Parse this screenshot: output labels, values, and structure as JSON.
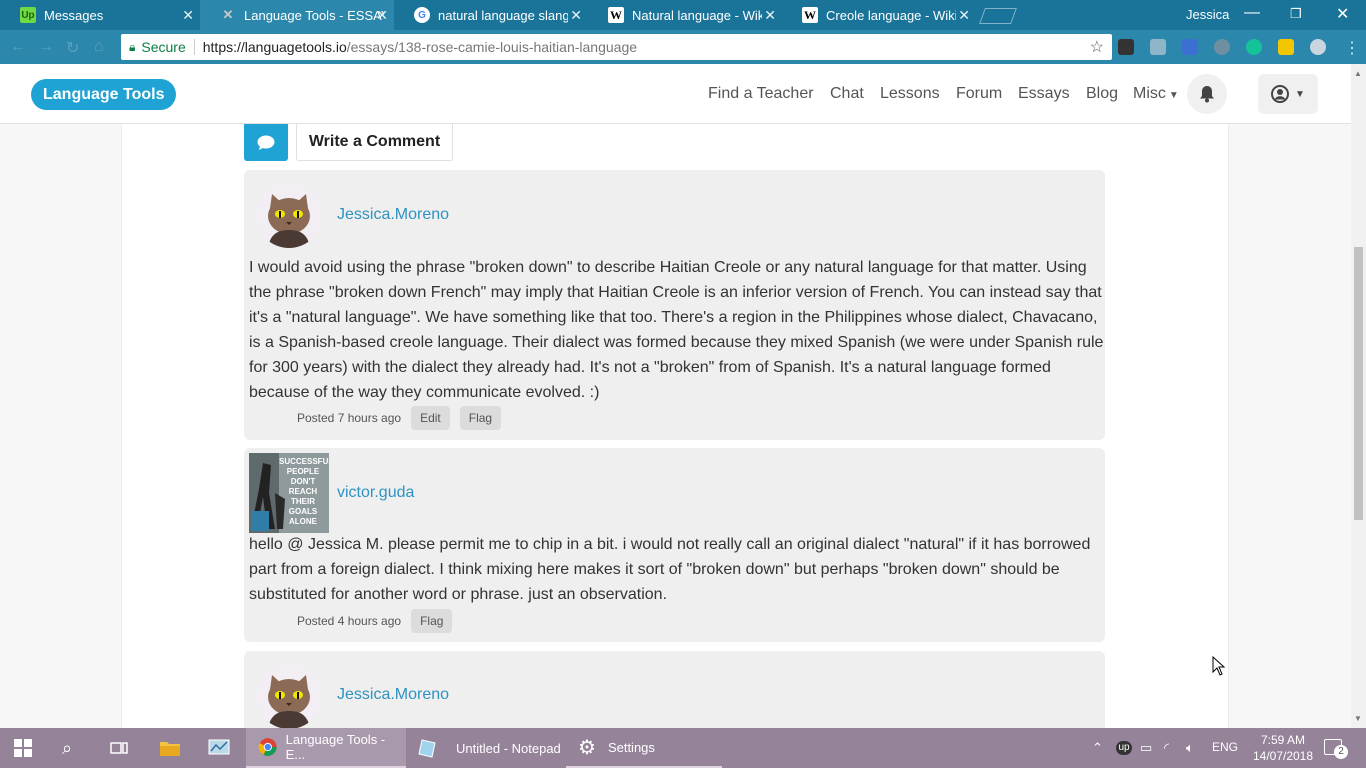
{
  "browser": {
    "tabs": [
      {
        "title": "Messages",
        "fav": "Up",
        "fav_bg": "#6fda44",
        "fav_fg": "#1f5f0a"
      },
      {
        "title": "Language Tools - ESSAYS",
        "fav": "✕",
        "fav_bg": "#7a8c96",
        "fav_fg": "#fff"
      },
      {
        "title": "natural language slang -",
        "fav": "G",
        "fav_bg": "#fff",
        "fav_fg": "#4285f4"
      },
      {
        "title": "Natural language - Wikip",
        "fav": "W",
        "fav_bg": "#fff",
        "fav_fg": "#000"
      },
      {
        "title": "Creole language - Wikipe",
        "fav": "W",
        "fav_bg": "#fff",
        "fav_fg": "#000"
      }
    ],
    "active_tab": 1,
    "user": "Jessica",
    "secure_label": "Secure",
    "url_host": "https://languagetools.io",
    "url_path": "/essays/138-rose-camie-louis-haitian-language"
  },
  "site": {
    "brand": "Language Tools",
    "nav": [
      "Find a Teacher",
      "Chat",
      "Lessons",
      "Forum",
      "Essays",
      "Blog",
      "Misc"
    ],
    "write_comment": "Write a Comment"
  },
  "comments": [
    {
      "user": "Jessica.Moreno",
      "text": "I would avoid using the phrase \"broken down\" to describe Haitian Creole or any natural language for that matter. Using the phrase \"broken down French\" may imply that Haitian Creole is an inferior version of French. You can instead say that it's a \"natural language\". We have something like that too. There's a region in the Philippines whose dialect, Chavacano, is a Spanish-based creole language. Their dialect was formed because they mixed Spanish (we were under Spanish rule for 300 years) with the dialect they already had. It's not a \"broken\" from of Spanish. It's a natural language formed because of the way they communicate evolved. :)",
      "posted": "Posted 7 hours ago",
      "actions": [
        "Edit",
        "Flag"
      ]
    },
    {
      "user": "victor.guda",
      "avatar_text": "SUCCESSFUL PEOPLE DON'T REACH THEIR GOALS ALONE",
      "text": "hello @ Jessica M. please permit me to chip in a bit. i would not really call an original dialect \"natural\" if it has borrowed part from a foreign dialect. I think mixing here makes it sort of \"broken down\" but perhaps \"broken down\" should be substituted for another word or phrase. just an observation.",
      "posted": "Posted 4 hours ago",
      "actions": [
        "Flag"
      ]
    },
    {
      "user": "Jessica.Moreno"
    }
  ],
  "taskbar": {
    "apps": [
      "Language Tools - E...",
      "Untitled - Notepad",
      "Settings"
    ],
    "lang": "ENG",
    "time": "7:59 AM",
    "date": "14/07/2018",
    "notifications": "2"
  }
}
